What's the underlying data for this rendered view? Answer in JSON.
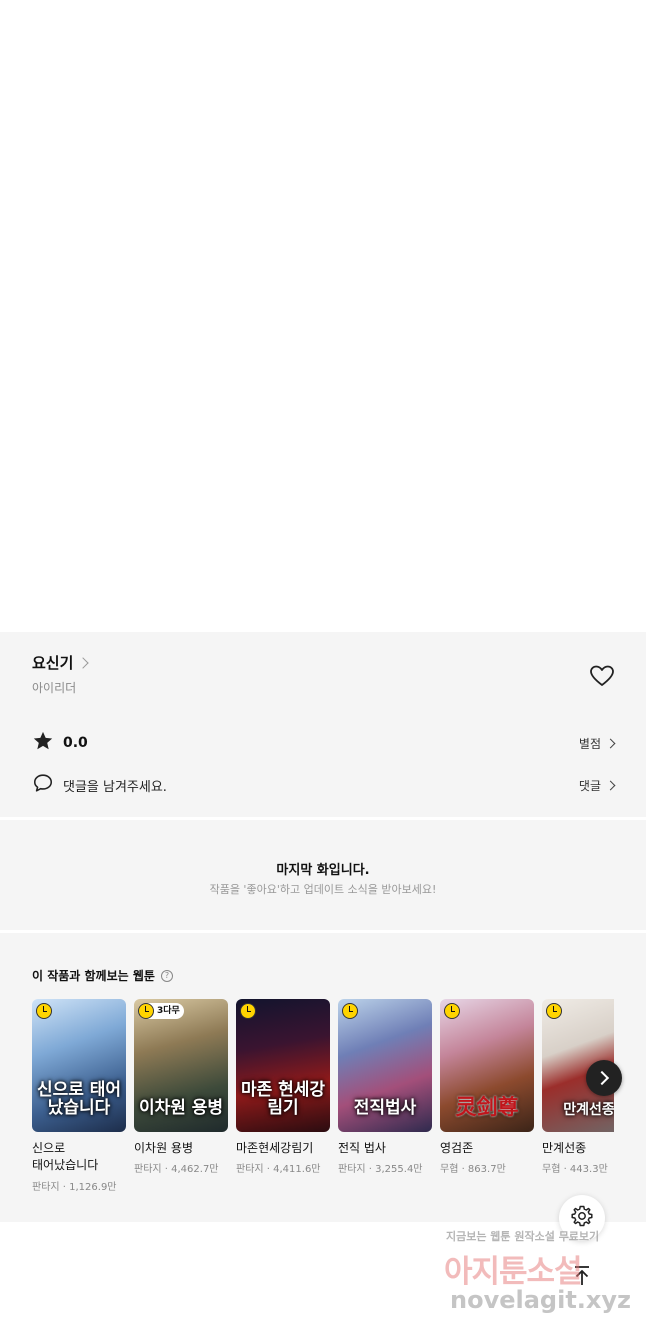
{
  "work": {
    "title": "요신기",
    "author": "아이리더",
    "rating": "0.0",
    "rating_link": "별점",
    "comment_prompt": "댓글을 남겨주세요.",
    "comment_link": "댓글"
  },
  "last_episode": {
    "title": "마지막 화입니다.",
    "subtitle": "작품을 '좋아요'하고 업데이트 소식을 받아보세요!"
  },
  "recommendations": {
    "heading": "이 작품과 함께보는 웹툰",
    "help": "?",
    "items": [
      {
        "name": "신으로 태어났습니다",
        "meta": "판타지 · 1,126.9만",
        "thumb_text": "신으로 태어났습니다",
        "badge": ""
      },
      {
        "name": "이차원 용병",
        "meta": "판타지 · 4,462.7만",
        "thumb_text": "이차원 용병",
        "badge": "3다무"
      },
      {
        "name": "마존현세강림기",
        "meta": "판타지 · 4,411.6만",
        "thumb_text": "마존 현세강림기",
        "badge": ""
      },
      {
        "name": "전직 법사",
        "meta": "판타지 · 3,255.4만",
        "thumb_text": "전직법사",
        "badge": ""
      },
      {
        "name": "영검존",
        "meta": "무협 · 863.7만",
        "thumb_text": "灵剑尊",
        "badge": ""
      },
      {
        "name": "만계선종",
        "meta": "무협 · 443.3만",
        "thumb_text": "만계선종",
        "badge": ""
      }
    ]
  },
  "watermark": {
    "line1": "지금보는 웹툰 원작소설 무료보기",
    "line2": "아지툰소설",
    "line3": "novelagit.xyz"
  },
  "colors": {
    "panel_bg": "#f5f5f5",
    "badge_yellow": "#ffd400"
  },
  "icons": [
    "chevron-right-icon",
    "heart-icon",
    "star-icon",
    "comment-icon",
    "help-icon",
    "next-arrow-icon",
    "settings-gear-icon",
    "scroll-top-icon"
  ]
}
